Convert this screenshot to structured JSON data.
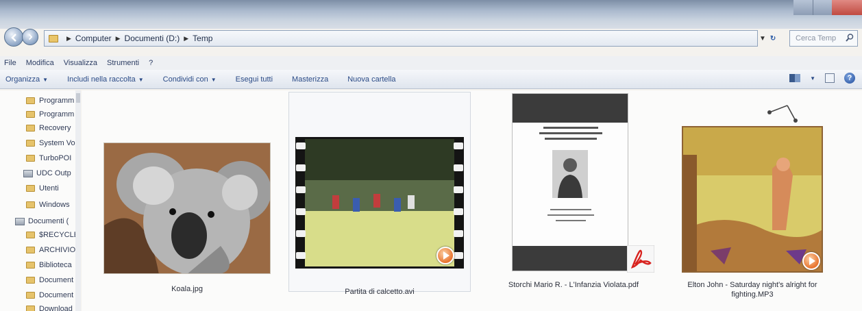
{
  "window": {
    "breadcrumb": [
      "Computer",
      "Documenti (D:)",
      "Temp"
    ],
    "search_placeholder": "Cerca Temp"
  },
  "menu": [
    "File",
    "Modifica",
    "Visualizza",
    "Strumenti",
    "?"
  ],
  "toolbar": {
    "organize": "Organizza",
    "include": "Includi nella raccolta",
    "share": "Condividi con",
    "play_all": "Esegui tutti",
    "slideshow": "Masterizza",
    "new_folder": "Nuova cartella"
  },
  "sidebar": {
    "items": [
      {
        "label": "Programm",
        "icon": "folder-icon"
      },
      {
        "label": "Programm",
        "icon": "folder-icon"
      },
      {
        "label": "Recovery",
        "icon": "folder-icon"
      },
      {
        "label": "System Vo",
        "icon": "folder-icon"
      },
      {
        "label": "TurboPOI",
        "icon": "folder-icon"
      },
      {
        "label": "UDC Outp",
        "icon": "drive-icon"
      },
      {
        "label": "Utenti",
        "icon": "folder-icon"
      },
      {
        "label": "Windows",
        "icon": "folder-icon"
      },
      {
        "label": "Documenti (",
        "icon": "drive-icon"
      },
      {
        "label": "$RECYCLE",
        "icon": "folder-icon"
      },
      {
        "label": "ARCHIVIO",
        "icon": "folder-icon"
      },
      {
        "label": "Biblioteca",
        "icon": "folder-icon"
      },
      {
        "label": "Document",
        "icon": "folder-icon"
      },
      {
        "label": "Document",
        "icon": "folder-icon"
      },
      {
        "label": "Download",
        "icon": "folder-icon"
      }
    ]
  },
  "files": [
    {
      "name": "Koala.jpg",
      "type": "image"
    },
    {
      "name": "Partita di calcetto.avi",
      "type": "video"
    },
    {
      "name": "Storchi Mario R. - L'Infanzia Violata.pdf",
      "type": "pdf"
    },
    {
      "name_line1": "Elton John - Saturday night's alright for",
      "name_line2": "fighting.MP3",
      "type": "audio"
    }
  ],
  "colors": {
    "accent": "#2a4a86",
    "pdf_red": "#d8231f",
    "play_orange": "#e8742f"
  }
}
